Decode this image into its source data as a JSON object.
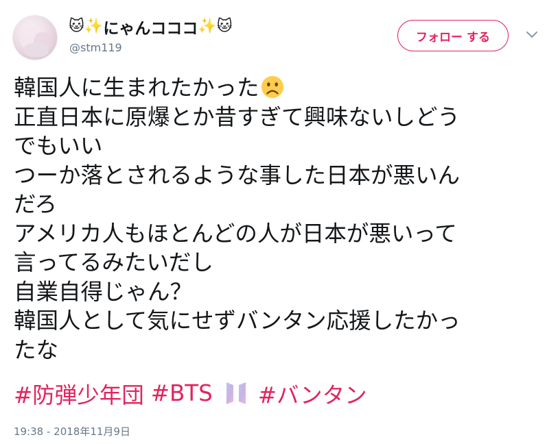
{
  "user": {
    "display_name_prefix": "🐱✨",
    "display_name_text": "にゃんコココ",
    "display_name_suffix": "✨🐱",
    "handle": "@stm119",
    "avatar_icon": "avatar-image"
  },
  "actions": {
    "follow_label": "フォロー する",
    "more_icon": "chevron-down-icon"
  },
  "tweet": {
    "lines": [
      "韓国人に生まれたかった",
      "正直日本に原爆とか昔すぎて興味ないしどう",
      "でもいい",
      "つーか落とされるような事した日本が悪いん",
      "だろ",
      "アメリカ人もほとんどの人が日本が悪いって",
      "言ってるみたいだし",
      "自業自得じゃん？",
      "韓国人として気にせずバンタン応援したかっ",
      "たな"
    ],
    "emoji_icon": "frowning-face-icon",
    "hashtags": [
      "#防弾少年団",
      "#BTS",
      "#バンタン"
    ],
    "hashtag_emoji_icon": "bts-logo-icon",
    "timestamp": "19:38 - 2018年11月9日"
  },
  "colors": {
    "accent": "#e0245e",
    "text": "#14171a",
    "muted": "#657786"
  }
}
